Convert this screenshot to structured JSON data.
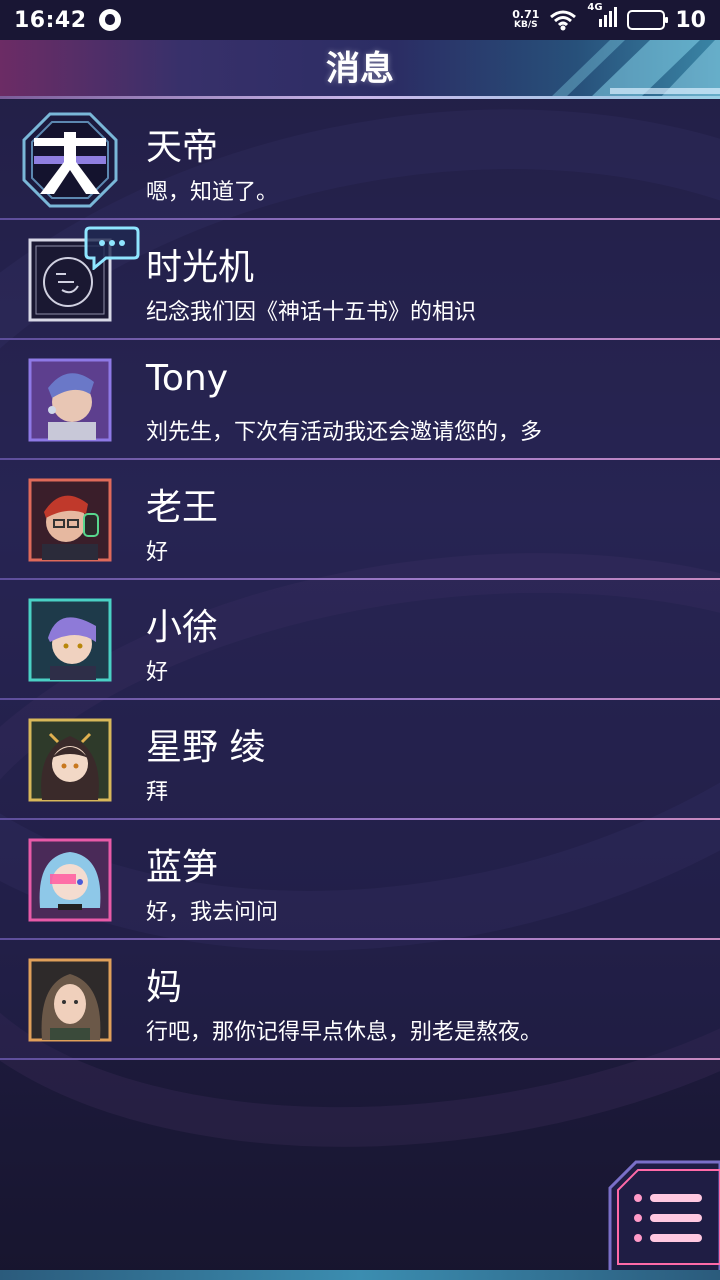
{
  "status_bar": {
    "time": "16:42",
    "net_speed_value": "0.71",
    "net_speed_unit": "KB/S",
    "network_type": "4G",
    "battery_level": "10",
    "icons": [
      "notification-icon",
      "wifi-icon",
      "signal-icon",
      "battery-icon"
    ]
  },
  "header": {
    "title": "消息"
  },
  "chats": [
    {
      "name": "天帝",
      "preview": "嗯，知道了。",
      "avatar": "tiandi-logo",
      "frame_color": "#7ab7d8"
    },
    {
      "name": "时光机",
      "preview": "纪念我们因《神话十五书》的相识",
      "avatar": "time-machine-logo",
      "frame_color": "#d8d8e6"
    },
    {
      "name": "Tony",
      "preview": "刘先生，下次有活动我还会邀请您的，多",
      "avatar": "tony-portrait",
      "frame_color": "#8e79e6"
    },
    {
      "name": "老王",
      "preview": "好",
      "avatar": "laowang-portrait",
      "frame_color": "#e06a5a"
    },
    {
      "name": "小徐",
      "preview": "好",
      "avatar": "xiaoxu-portrait",
      "frame_color": "#4ad1c5"
    },
    {
      "name": "星野 绫",
      "preview": "拜",
      "avatar": "hoshino-portrait",
      "frame_color": "#d8b85a"
    },
    {
      "name": "蓝笋",
      "preview": "好，我去问问",
      "avatar": "lansun-portrait",
      "frame_color": "#e85aa8"
    },
    {
      "name": "妈",
      "preview": "行吧，那你记得早点休息，别老是熬夜。",
      "avatar": "mom-portrait",
      "frame_color": "#e0a05a"
    }
  ],
  "menu": {
    "icon": "menu-icon"
  }
}
